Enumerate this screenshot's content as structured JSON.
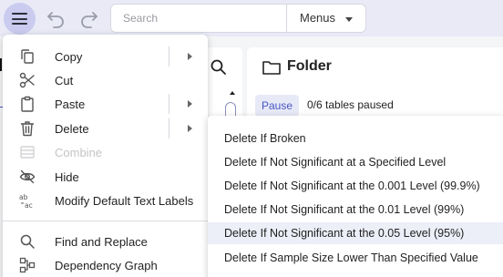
{
  "toolbar": {
    "search_placeholder": "Search",
    "menus_select_value": "Menus",
    "icons": [
      "hamburger-menu-icon",
      "undo-icon",
      "redo-icon",
      "chevron-down-icon"
    ]
  },
  "folder": {
    "title": "Folder",
    "pause_label": "Pause",
    "paused_status": "0/6 tables paused"
  },
  "context_menu": {
    "items": [
      {
        "label": "Copy",
        "icon": "copy-icon",
        "has_submenu": true,
        "disabled": false
      },
      {
        "label": "Cut",
        "icon": "scissors-icon",
        "has_submenu": false,
        "disabled": false
      },
      {
        "label": "Paste",
        "icon": "clipboard-icon",
        "has_submenu": true,
        "disabled": false
      },
      {
        "label": "Delete",
        "icon": "trash-icon",
        "has_submenu": true,
        "disabled": false
      },
      {
        "label": "Combine",
        "icon": "combine-icon",
        "has_submenu": false,
        "disabled": true
      },
      {
        "label": "Hide",
        "icon": "eye-off-icon",
        "has_submenu": false,
        "disabled": false
      },
      {
        "label": "Modify Default Text Labels",
        "icon": "text-labels-icon",
        "has_submenu": false,
        "disabled": false
      },
      {
        "label": "Find and Replace",
        "icon": "search-icon",
        "has_submenu": false,
        "disabled": false
      },
      {
        "label": "Dependency Graph",
        "icon": "dependency-graph-icon",
        "has_submenu": false,
        "disabled": false
      }
    ]
  },
  "delete_submenu": {
    "items": [
      {
        "label": "Delete If Broken"
      },
      {
        "label": "Delete If Not Significant at a Specified Level"
      },
      {
        "label": "Delete If Not Significant at the 0.001 Level (99.9%)"
      },
      {
        "label": "Delete If Not Significant at the 0.01 Level (99%)"
      },
      {
        "label": "Delete If Not Significant at the 0.05 Level (95%)",
        "highlighted": true
      },
      {
        "label": "Delete If Sample Size Lower Than Specified Value"
      }
    ]
  },
  "colors": {
    "toolbar_bg": "#e9eaf6",
    "hamburger_bg": "#c9cbef",
    "accent": "#4857c2",
    "highlight_bg": "#eceef8"
  }
}
